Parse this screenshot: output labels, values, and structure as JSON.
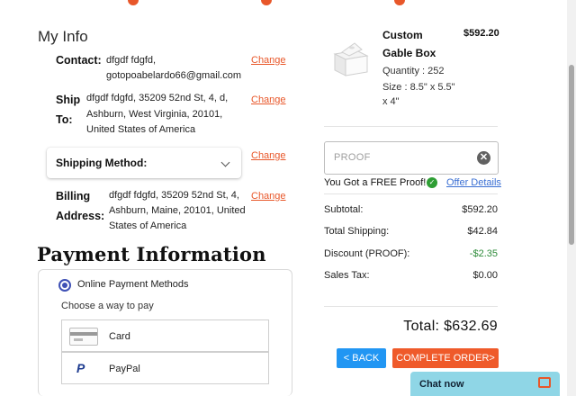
{
  "my_info": {
    "heading": "My Info",
    "contact_label": "Contact:",
    "contact_lines": [
      "dfgdf fdgfd,",
      "gotopoabelardo66@gmail.com"
    ],
    "ship_to_label_1": "Ship",
    "ship_to_label_2": "To:",
    "ship_to_lines": [
      "dfgdf fdgfd, 35209 52nd St, 4, d,",
      "Ashburn, West Virginia, 20101,",
      "United States of America"
    ],
    "shipping_method_label": "Shipping Method:",
    "billing_label_1": "Billing",
    "billing_label_2": "Address:",
    "billing_lines": [
      "dfgdf fdgfd, 35209 52nd St, 4,",
      "Ashburn, Maine, 20101, United",
      "States of America"
    ],
    "change_label": "Change"
  },
  "payment": {
    "heading": "Payment Information",
    "option_label": "Online Payment Methods",
    "choose_text": "Choose a way to pay",
    "methods": [
      {
        "name": "Card",
        "icon": "credit-card-icon"
      },
      {
        "name": "PayPal",
        "icon": "paypal-icon"
      }
    ],
    "paypal_glyph": "P"
  },
  "order": {
    "product_name_1": "Custom",
    "product_name_2": "Gable Box",
    "product_price": "$592.20",
    "quantity": "Quantity : 252",
    "size_1": "Size : 8.5\" x 5.5\"",
    "size_2": "x 4\"",
    "promo_placeholder": "PROOF",
    "promo_clear": "✕",
    "free_proof_text": "You Got a FREE Proof!",
    "check_glyph": "✓",
    "offer_details": "Offer Details",
    "summary": [
      {
        "label": "Subtotal:",
        "value": "$592.20"
      },
      {
        "label": "Total Shipping:",
        "value": "$42.84"
      },
      {
        "label": "Discount (PROOF):",
        "value": "-$2.35"
      },
      {
        "label": "Sales Tax:",
        "value": "$0.00"
      }
    ],
    "total_label": "Total:",
    "total_value": "$632.69",
    "back_button": "< BACK",
    "complete_button": "COMPLETE ORDER>"
  },
  "chat": {
    "label": "Chat now"
  },
  "colors": {
    "accent": "#e8572a",
    "back_button": "#2196f3",
    "complete_button": "#ef5a2a",
    "discount": "#2e8b3a",
    "link": "#3a6fd3",
    "chat_bg": "#8fd6e6"
  }
}
